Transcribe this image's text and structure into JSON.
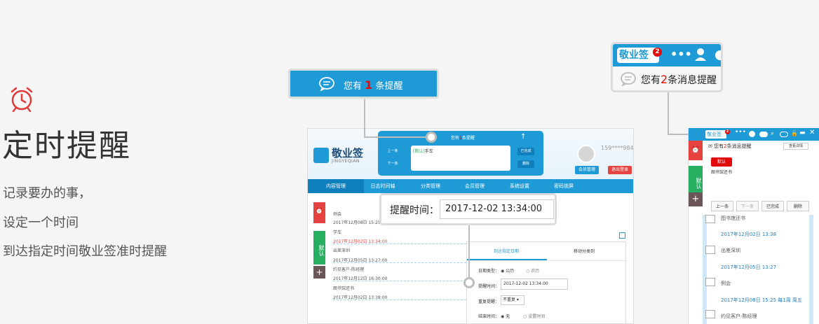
{
  "intro": {
    "title": "定时提醒",
    "lines": [
      "记录要办的事，",
      "设定一个时间",
      "到达指定时间敬业签准时提醒"
    ]
  },
  "callout_reminder": {
    "prefix": "您有",
    "count": "1",
    "suffix": "条提醒"
  },
  "callout_time": {
    "label": "提醒时间：",
    "value": "2017-12-02 13:34:00"
  },
  "callout_messages": {
    "logo": "敬业签",
    "badge": "2",
    "prefix": "您有",
    "count": "2",
    "suffix": "条消息提醒"
  },
  "app": {
    "logo": "敬业签",
    "logo_sub": "JINGYEQIAN",
    "phone": "159****9845",
    "member_btn": "会员管理",
    "logout_btn": "退出登录",
    "nav": [
      "内容管理",
      "日志时间轴",
      "分类管理",
      "会员管理",
      "系统设置",
      "密码锁屏"
    ],
    "popup": {
      "title_prefix": "您有",
      "title_count": "1",
      "title_suffix": "条提醒",
      "prev": "上一条",
      "next": "下一条",
      "tag": "[默认]",
      "content": "手车",
      "done": "已完成",
      "delete": "删除"
    },
    "side_tags": [
      "默认"
    ],
    "list": [
      {
        "title": "例会",
        "date": "2017年12月08日 15:25:00"
      },
      {
        "title": "学车",
        "date": "2017年12月02日 13:34:00"
      },
      {
        "title": "出差深圳",
        "date": "2017年12月05日 13:27:00"
      },
      {
        "title": "约见客户-陈经理",
        "date": "2017年12月12日 16:30:00"
      },
      {
        "title": "图书馆还书",
        "date": "2017年12月02日 13:38:00"
      }
    ],
    "form": {
      "tab_active": "到达指定日期",
      "tab_other": "移动分类到",
      "date_type_label": "日期类型：",
      "opt_solar": "公历",
      "opt_lunar": "农历",
      "remind_label": "提醒时间：",
      "remind_value": "2017-12-02 13:34:00",
      "repeat_label": "重复提醒：",
      "repeat_value": "不重复",
      "end_label": "结束时间：",
      "end_none": "无",
      "end_set": "设置时间"
    }
  },
  "side_app": {
    "logo": "敬业签",
    "msg_prefix": "您有",
    "msg_count": "2",
    "msg_suffix": "条消息提醒",
    "detail_btn": "查看详情",
    "tag": "默认",
    "content": "图书馆还书",
    "tabs": [
      "默认"
    ],
    "prev": "上一条",
    "next": "下一条",
    "done": "已完成",
    "delete": "删除",
    "items": [
      {
        "title": "图书馆还书",
        "date": "2017年12月02日 13:38"
      },
      {
        "title": "出差深圳",
        "date": "2017年12月05日 13:27"
      },
      {
        "title": "例会",
        "date": "2017年12月08日 15:25 每1周 周五"
      },
      {
        "title": "约见客户-陈经理",
        "date": ""
      }
    ]
  },
  "colors": {
    "brand": "#1e9ad6",
    "alert": "#e00a0a",
    "green": "#27ae60"
  }
}
